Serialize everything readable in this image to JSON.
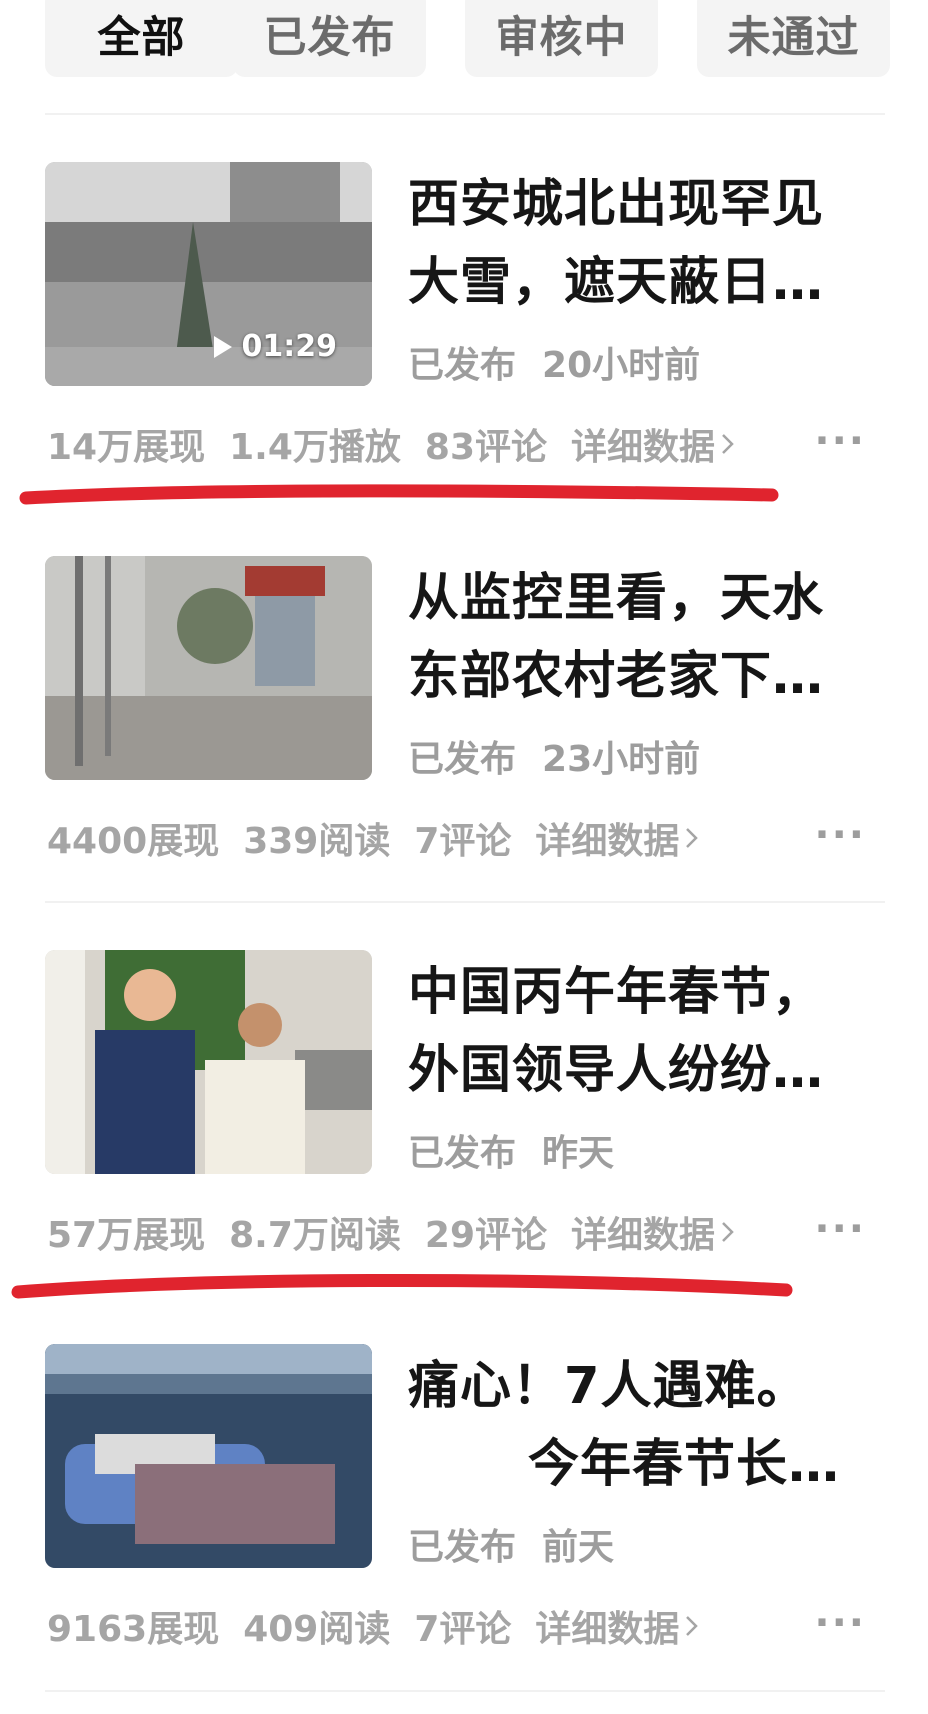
{
  "tabs": [
    {
      "label": "全部",
      "active": true
    },
    {
      "label": "已发布",
      "active": false
    },
    {
      "label": "审核中",
      "active": false
    },
    {
      "label": "未通过",
      "active": false
    }
  ],
  "articles": [
    {
      "title_line1": "西安城北出现罕见",
      "title_line2": "大雪，遮天蔽日…",
      "status": "已发布",
      "time": "20小时前",
      "duration": "01:29",
      "stats": [
        "14万展现",
        "1.4万播放",
        "83评论"
      ],
      "detail_label": "详细数据"
    },
    {
      "title_line1": "从监控里看，天水",
      "title_line2": "东部农村老家下…",
      "status": "已发布",
      "time": "23小时前",
      "stats": [
        "4400展现",
        "339阅读",
        "7评论"
      ],
      "detail_label": "详细数据"
    },
    {
      "title_line1": "中国丙午年春节，",
      "title_line2": "外国领导人纷纷…",
      "status": "已发布",
      "time": "昨天",
      "stats": [
        "57万展现",
        "8.7万阅读",
        "29评论"
      ],
      "detail_label": "详细数据"
    },
    {
      "title_line1": "痛心！7人遇难。",
      "title_line2": "今年春节长…",
      "status": "已发布",
      "time": "前天",
      "stats": [
        "9163展现",
        "409阅读",
        "7评论"
      ],
      "detail_label": "详细数据"
    }
  ],
  "more_glyph": "···",
  "colors": {
    "accent_red": "#e0242e",
    "text_dark": "#161616",
    "text_gray": "#9d9d9d"
  },
  "icons": [
    "play-icon",
    "chevron-right-icon",
    "more-icon"
  ]
}
